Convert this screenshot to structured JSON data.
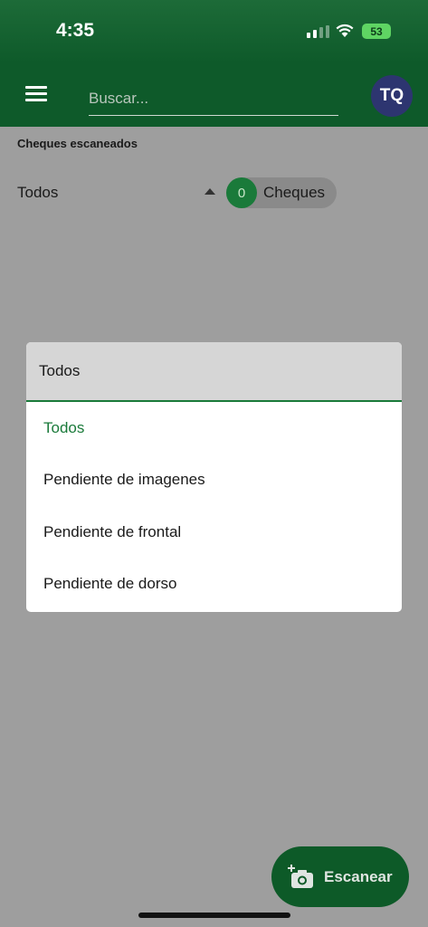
{
  "status_bar": {
    "time": "4:35",
    "battery": "53"
  },
  "app_bar": {
    "search_placeholder": "Buscar...",
    "avatar_initials": "TQ"
  },
  "main": {
    "section_title": "Cheques escaneados",
    "filter_selected": "Todos",
    "count": "0",
    "count_label": "Cheques"
  },
  "dropdown": {
    "header": "Todos",
    "options": [
      {
        "label": "Todos",
        "selected": true
      },
      {
        "label": "Pendiente de imagenes"
      },
      {
        "label": "Pendiente de frontal"
      },
      {
        "label": "Pendiente de dorso"
      }
    ]
  },
  "fab": {
    "label": "Escanear"
  },
  "colors": {
    "primary": "#0e5a2a",
    "accent": "#1a7a3a",
    "avatar": "#2d3570"
  },
  "icons": [
    "menu-icon",
    "signal-icon",
    "wifi-icon",
    "battery-icon",
    "arrow-up-icon",
    "camera-add-icon"
  ]
}
